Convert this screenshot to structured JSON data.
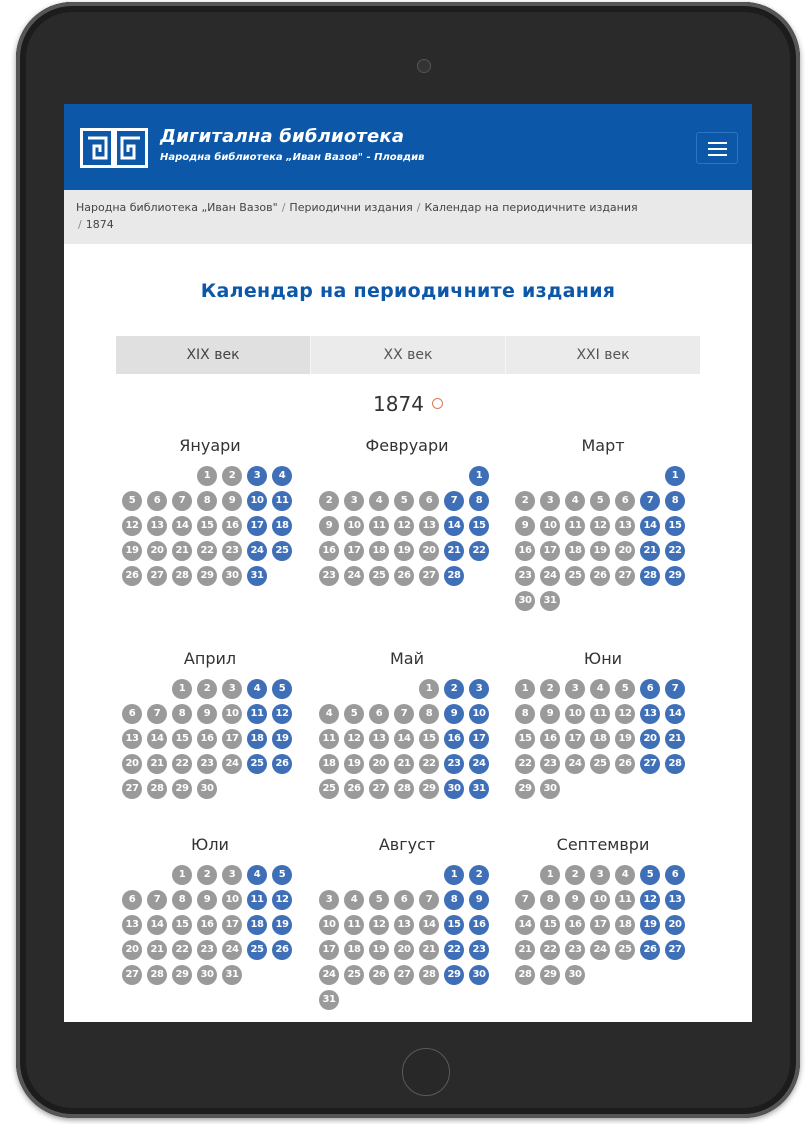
{
  "header": {
    "title": "Дигитална библиотека",
    "subtitle": "Народна библиотека „Иван Вазов\" - Пловдив",
    "logo": "book-logo-icon",
    "menu_icon": "hamburger-menu-icon"
  },
  "breadcrumb": {
    "items": [
      "Народна библиотека „Иван Вазов\"",
      "Периодични издания",
      "Календар на периодичните издания",
      "1874"
    ]
  },
  "page_title": "Календар на периодичните издания",
  "century_tabs": [
    "XIX век",
    "XX век",
    "XXI век"
  ],
  "year": "1874",
  "colors": {
    "header": "#0c57a8",
    "day_available": "#3f6fb7",
    "day_unavailable": "#9a9a9a"
  },
  "months": [
    {
      "name": "Януари",
      "days": 31,
      "first_weekday": 3,
      "blue": [
        3,
        4,
        10,
        11,
        17,
        18,
        24,
        25,
        31
      ]
    },
    {
      "name": "Февруари",
      "days": 28,
      "first_weekday": 6,
      "blue": [
        1,
        7,
        8,
        14,
        15,
        21,
        22,
        28
      ]
    },
    {
      "name": "Март",
      "days": 31,
      "first_weekday": 6,
      "blue": [
        1,
        7,
        8,
        14,
        15,
        21,
        22,
        28,
        29
      ]
    },
    {
      "name": "Април",
      "days": 30,
      "first_weekday": 2,
      "blue": [
        4,
        5,
        11,
        12,
        18,
        19,
        25,
        26
      ]
    },
    {
      "name": "Май",
      "days": 31,
      "first_weekday": 4,
      "blue": [
        2,
        3,
        9,
        10,
        16,
        17,
        23,
        24,
        30,
        31
      ]
    },
    {
      "name": "Юни",
      "days": 30,
      "first_weekday": 0,
      "blue": [
        6,
        7,
        13,
        14,
        20,
        21,
        27,
        28
      ]
    },
    {
      "name": "Юли",
      "days": 31,
      "first_weekday": 2,
      "blue": [
        4,
        5,
        11,
        12,
        18,
        19,
        25,
        26
      ]
    },
    {
      "name": "Август",
      "days": 31,
      "first_weekday": 5,
      "blue": [
        1,
        2,
        8,
        9,
        15,
        16,
        22,
        23,
        29,
        30
      ]
    },
    {
      "name": "Септември",
      "days": 30,
      "first_weekday": 1,
      "blue": [
        5,
        6,
        12,
        13,
        19,
        20,
        26,
        27
      ]
    }
  ]
}
